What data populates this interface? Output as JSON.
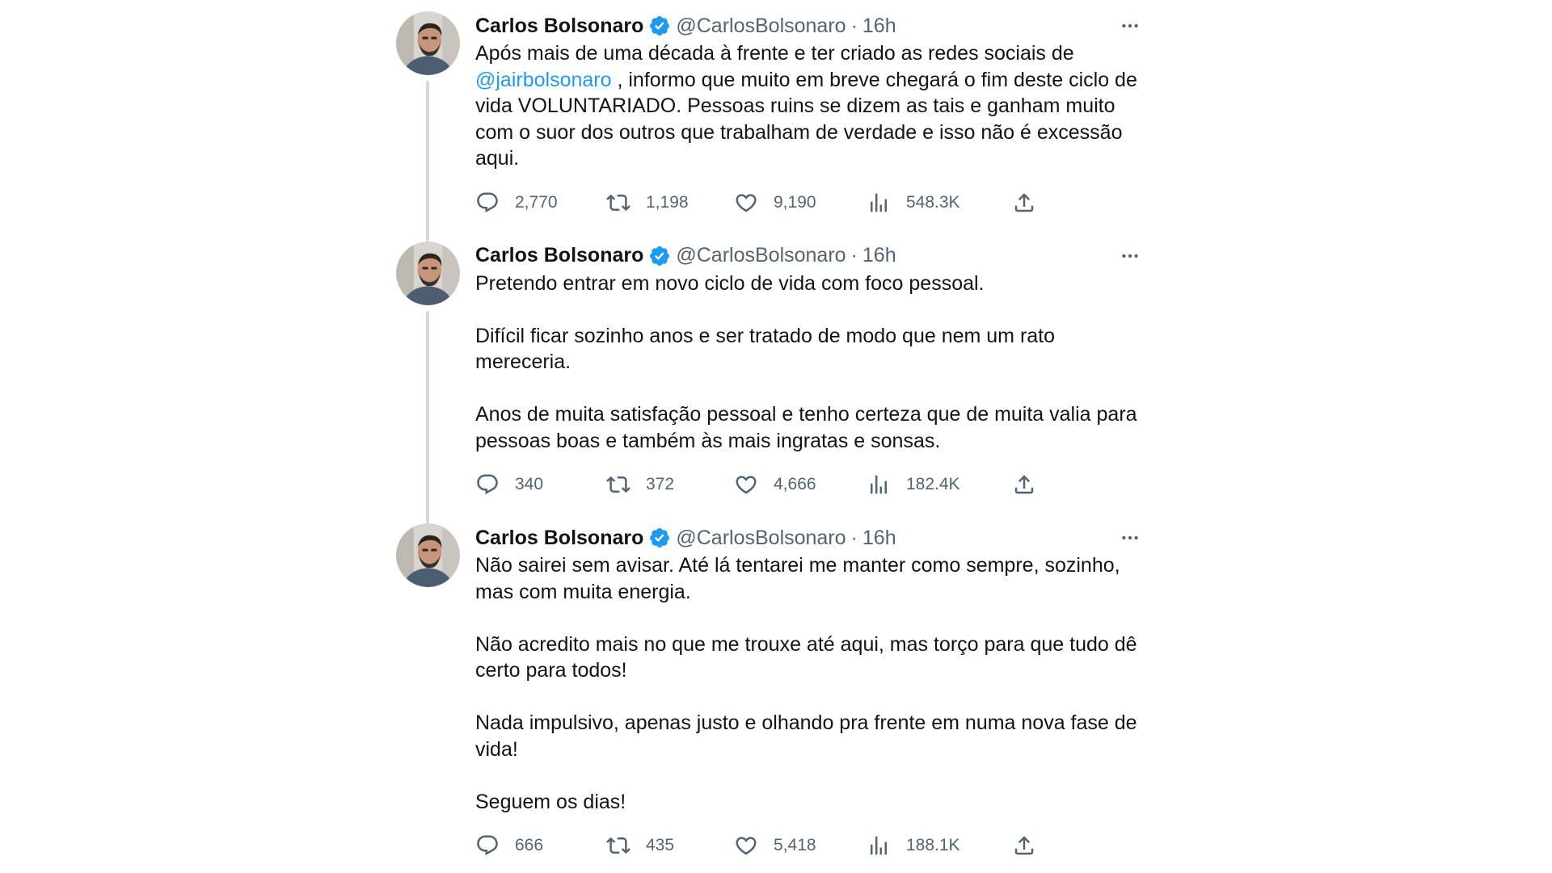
{
  "colors": {
    "mention": "#1d9bf0",
    "verified": "#1d9bf0",
    "muted": "#536471",
    "thread_line": "#cfd9de"
  },
  "tweets": [
    {
      "name": "Carlos Bolsonaro",
      "handle": "@CarlosBolsonaro",
      "separator": "·",
      "time": "16h",
      "text_before_mention": "Após mais de uma década à frente e ter criado as redes sociais de ",
      "mention": "@jairbolsonaro",
      "text_after_mention": " , informo que muito em breve chegará o fim deste ciclo de vida VOLUNTARIADO. Pessoas ruins se dizem as tais e ganham muito com o suor dos outros que trabalham de verdade e isso não é excessão aqui.",
      "replies": "2,770",
      "retweets": "1,198",
      "likes": "9,190",
      "views": "548.3K"
    },
    {
      "name": "Carlos Bolsonaro",
      "handle": "@CarlosBolsonaro",
      "separator": "·",
      "time": "16h",
      "paragraphs": [
        "Pretendo entrar em novo ciclo de vida com foco pessoal.",
        "Difícil ficar sozinho anos e ser tratado de modo que nem um rato mereceria.",
        "Anos de muita satisfação pessoal e tenho certeza que de muita valia para pessoas boas e também às mais ingratas e sonsas."
      ],
      "replies": "340",
      "retweets": "372",
      "likes": "4,666",
      "views": "182.4K"
    },
    {
      "name": "Carlos Bolsonaro",
      "handle": "@CarlosBolsonaro",
      "separator": "·",
      "time": "16h",
      "paragraphs": [
        "Não sairei sem avisar. Até lá tentarei me manter como sempre, sozinho, mas com muita energia.",
        "Não acredito mais no que me trouxe até aqui, mas torço para que tudo dê certo para todos!",
        "Nada impulsivo, apenas justo e olhando pra frente em numa nova fase de vida!",
        "Seguem os dias!"
      ],
      "replies": "666",
      "retweets": "435",
      "likes": "5,418",
      "views": "188.1K"
    }
  ],
  "icons": {
    "more": "more-horizontal-icon",
    "reply": "reply-bubble-icon",
    "retweet": "retweet-arrows-icon",
    "like": "heart-icon",
    "views": "bar-chart-icon",
    "share": "share-upload-icon",
    "verified": "verified-badge-icon"
  }
}
